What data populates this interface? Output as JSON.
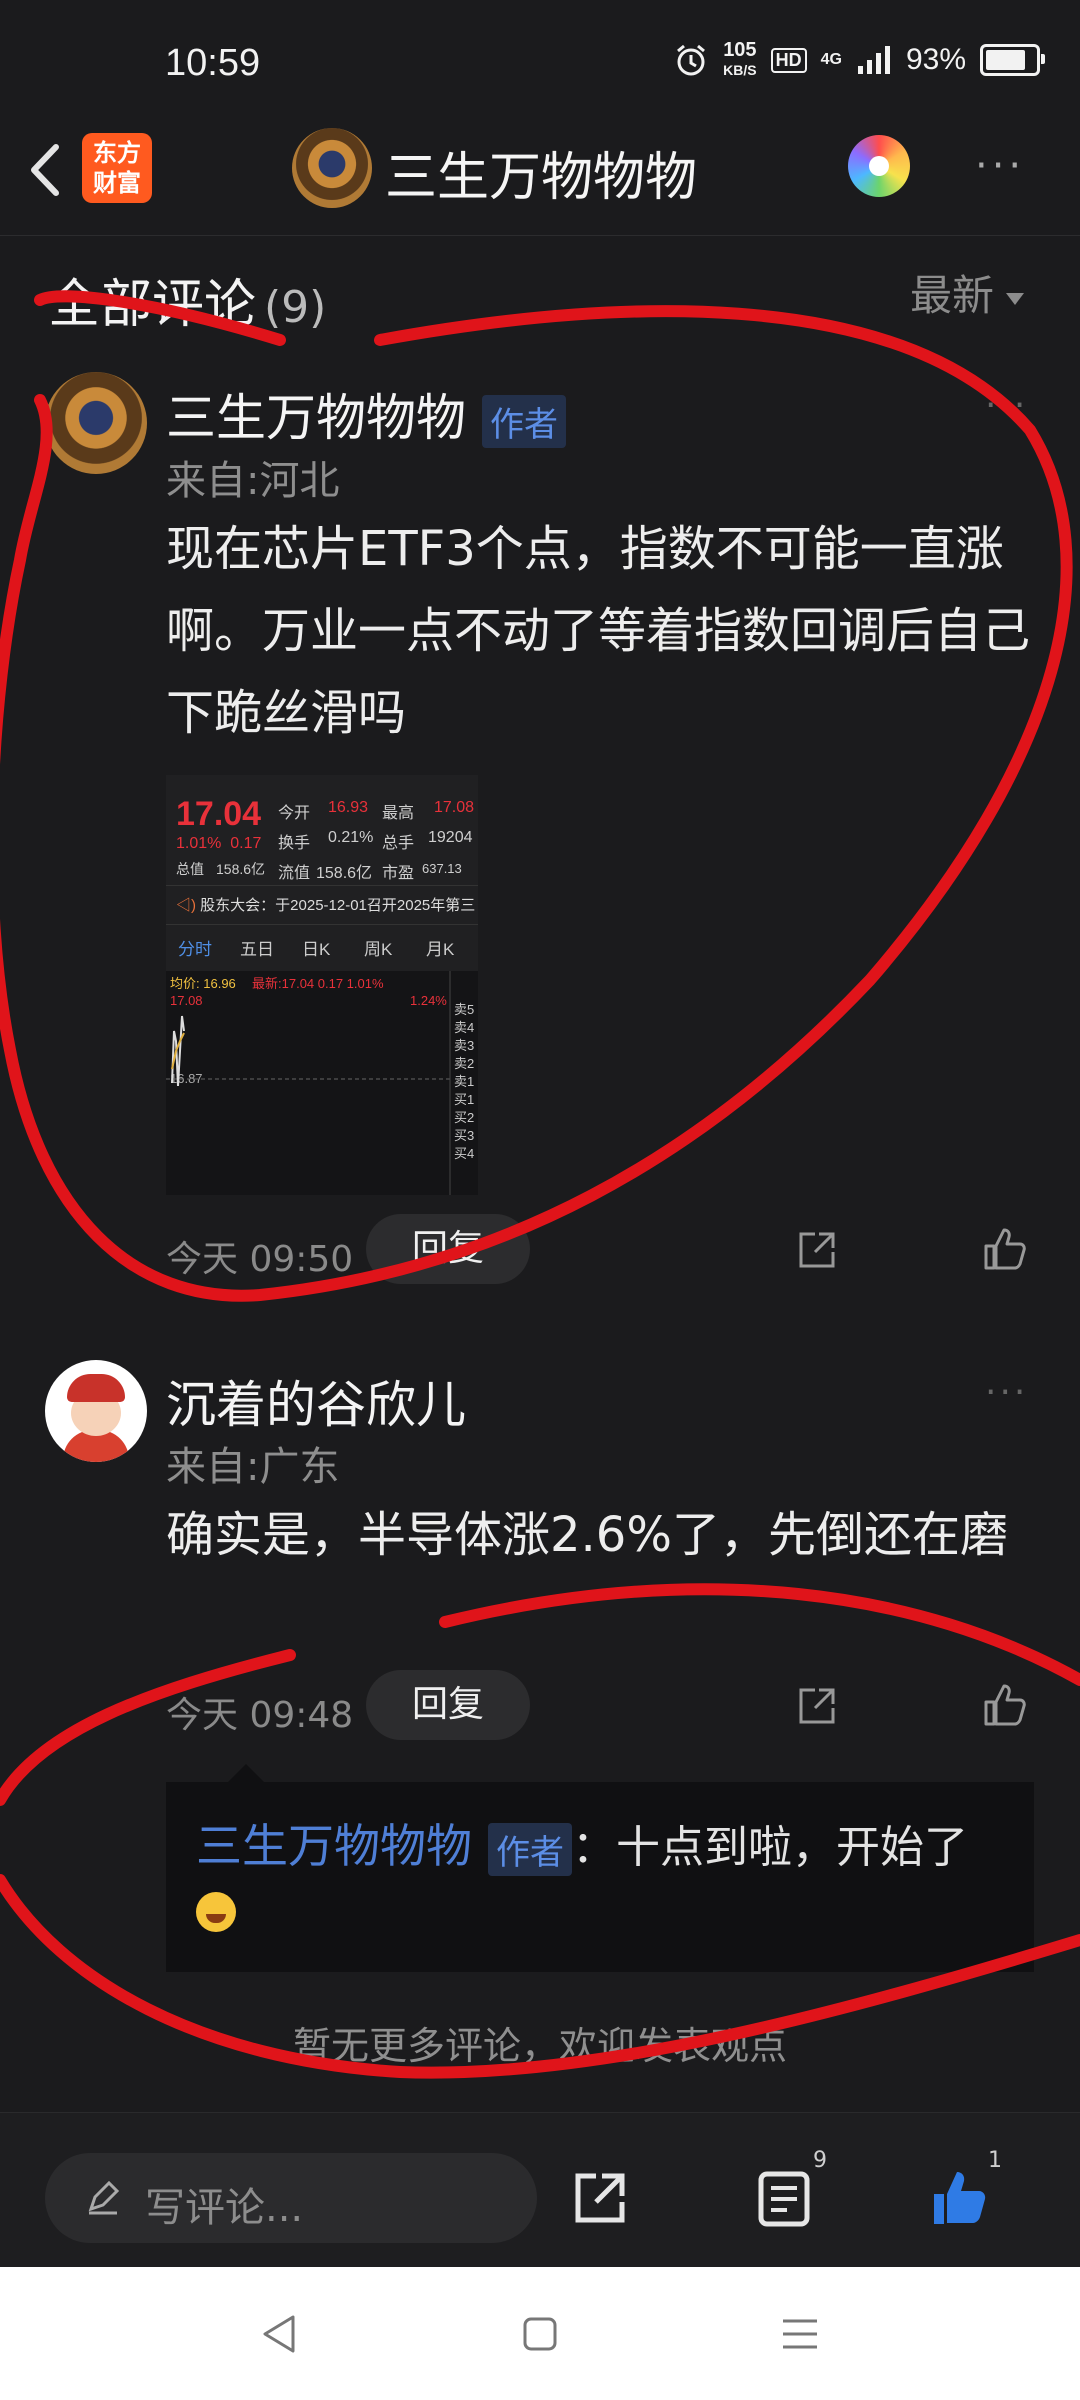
{
  "status_bar": {
    "time": "10:59",
    "net_speed_value": "105",
    "net_speed_unit": "KB/S",
    "hd": "HD",
    "network": "4G",
    "battery_text": "93%",
    "battery_level": 0.93
  },
  "header": {
    "logo_line1": "东方",
    "logo_line2": "财富",
    "title": "三生万物物物",
    "more": "···"
  },
  "comments_section": {
    "title": "全部评论",
    "count": "(9)",
    "sort_label": "最新"
  },
  "comments": [
    {
      "username": "三生万物物物",
      "badge": "作者",
      "location": "来自:河北",
      "content": "现在芯片ETF3个点，指数不可能一直涨啊。万业一点不动了等着指数回调后自己下跪丝滑吗",
      "time": "今天 09:50",
      "reply_label": "回复",
      "image": {
        "price": "17.04",
        "change_pct": "1.01%",
        "change": "0.17",
        "open_label": "今开",
        "open": "16.93",
        "high_label": "最高",
        "high": "17.08",
        "turnover_label": "换手",
        "turnover": "0.21%",
        "total_shares_label": "总手",
        "total_shares": "19204",
        "mktcap_label": "总值",
        "mktcap": "158.6亿",
        "float_label": "流值",
        "float_cap": "158.6亿",
        "pe_label": "市盈",
        "pe": "637.13",
        "notice": "股东大会：于2025-12-01召开2025年第三",
        "tabs": [
          "分时",
          "五日",
          "日K",
          "周K",
          "月K"
        ],
        "avg_label": "均价:",
        "avg": "16.96",
        "latest_label": "最新:",
        "latest": "17.04 0.17 1.01%",
        "top_price": "17.08",
        "top_pct": "1.24%",
        "mid_price": "16.87",
        "sell": [
          "卖5",
          "卖4",
          "卖3",
          "卖2",
          "卖1"
        ],
        "buy": [
          "买1",
          "买2",
          "买3",
          "买4"
        ]
      }
    },
    {
      "username": "沉着的谷欣儿",
      "location": "来自:广东",
      "content": "确实是，半导体涨2.6%了，先倒还在磨",
      "time": "今天 09:48",
      "reply_label": "回复",
      "reply": {
        "username": "三生万物物物",
        "badge": "作者",
        "text": "：十点到啦，开始了"
      }
    }
  ],
  "footer_note": "暂无更多评论，欢迎发表观点",
  "bottom_bar": {
    "input_placeholder": "写评论...",
    "comments_count": "9",
    "likes_count": "1"
  },
  "annotation_color": "#e0141a"
}
